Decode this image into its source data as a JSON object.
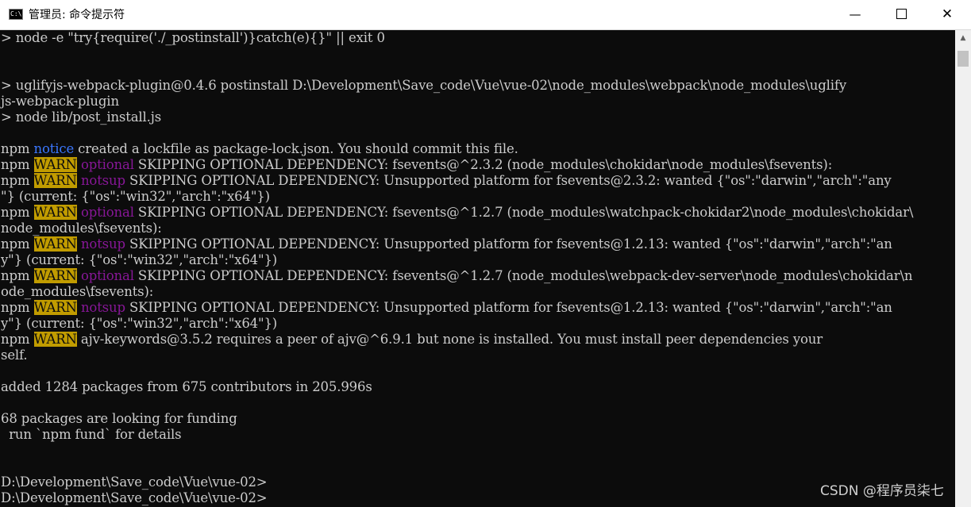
{
  "window": {
    "title": "管理员: 命令提示符",
    "icon_text": "C:\\",
    "minimize_glyph": "—",
    "close_glyph": "✕"
  },
  "colors": {
    "background": "#0c0c0c",
    "text": "#cccccc",
    "warn_bg": "#c19c00",
    "notice": "#3b78ff",
    "optional": "#881798"
  },
  "console": {
    "l1": "> node -e \"try{require('./_postinstall')}catch(e){}\" || exit 0",
    "l2": "> uglifyjs-webpack-plugin@0.4.6 postinstall D:\\Development\\Save_code\\Vue\\vue-02\\node_modules\\webpack\\node_modules\\uglify",
    "l3": "js-webpack-plugin",
    "l4": "> node lib/post_install.js",
    "npm": "npm",
    "warn": "WARN",
    "notice": "notice",
    "optional": "optional",
    "notsup": "notsup",
    "notice_msg": " created a lockfile as package-lock.json. You should commit this file.",
    "w1": " SKIPPING OPTIONAL DEPENDENCY: fsevents@^2.3.2 (node_modules\\chokidar\\node_modules\\fsevents):",
    "w2": " SKIPPING OPTIONAL DEPENDENCY: Unsupported platform for fsevents@2.3.2: wanted {\"os\":\"darwin\",\"arch\":\"any",
    "w2b": "\"} (current: {\"os\":\"win32\",\"arch\":\"x64\"})",
    "w3": " SKIPPING OPTIONAL DEPENDENCY: fsevents@^1.2.7 (node_modules\\watchpack-chokidar2\\node_modules\\chokidar\\",
    "w3b": "node_modules\\fsevents):",
    "w4": " SKIPPING OPTIONAL DEPENDENCY: Unsupported platform for fsevents@1.2.13: wanted {\"os\":\"darwin\",\"arch\":\"an",
    "w4b": "y\"} (current: {\"os\":\"win32\",\"arch\":\"x64\"})",
    "w5": " SKIPPING OPTIONAL DEPENDENCY: fsevents@^1.2.7 (node_modules\\webpack-dev-server\\node_modules\\chokidar\\n",
    "w5b": "ode_modules\\fsevents):",
    "w6": " SKIPPING OPTIONAL DEPENDENCY: Unsupported platform for fsevents@1.2.13: wanted {\"os\":\"darwin\",\"arch\":\"an",
    "w6b": "y\"} (current: {\"os\":\"win32\",\"arch\":\"x64\"})",
    "w7": " ajv-keywords@3.5.2 requires a peer of ajv@^6.9.1 but none is installed. You must install peer dependencies your",
    "w7b": "self.",
    "added": "added 1284 packages from 675 contributors in 205.996s",
    "fund1": "68 packages are looking for funding",
    "fund2": "  run `npm fund` for details",
    "prompt1": "D:\\Development\\Save_code\\Vue\\vue-02>",
    "prompt2": "D:\\Development\\Save_code\\Vue\\vue-02>"
  },
  "watermark": "CSDN @程序员柒七"
}
